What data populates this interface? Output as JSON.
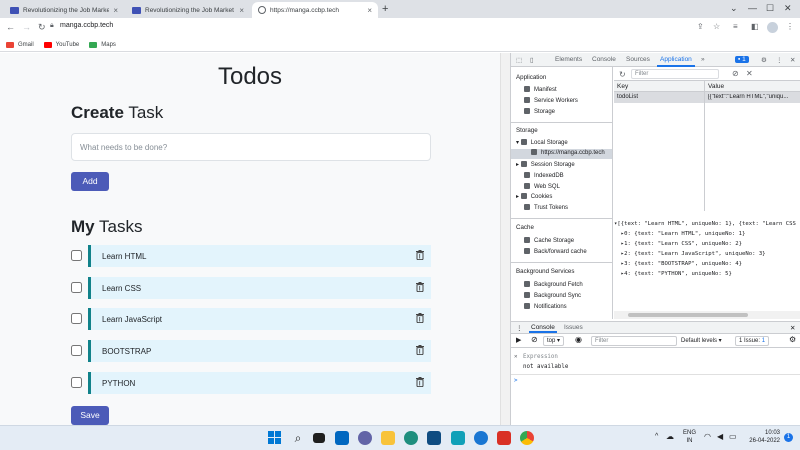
{
  "browser": {
    "tabs": [
      {
        "title": "Revolutionizing the Job Market |"
      },
      {
        "title": "Revolutionizing the Job Market |"
      },
      {
        "title": "https://manga.ccbp.tech"
      }
    ],
    "url": "manga.ccbp.tech",
    "bookmarks": [
      {
        "label": "Gmail",
        "color": "#ea4335"
      },
      {
        "label": "YouTube",
        "color": "#ff0000"
      },
      {
        "label": "Maps",
        "color": "#34a853"
      }
    ]
  },
  "app": {
    "title": "Todos",
    "create": {
      "bold": "Create",
      "rest": " Task"
    },
    "input_placeholder": "What needs to be done?",
    "add_label": "Add",
    "tasks_heading": {
      "bold": "My",
      "rest": " Tasks"
    },
    "tasks": [
      {
        "text": "Learn HTML",
        "checked": false
      },
      {
        "text": "Learn CSS",
        "checked": false
      },
      {
        "text": "Learn JavaScript",
        "checked": false
      },
      {
        "text": "BOOTSTRAP",
        "checked": false
      },
      {
        "text": "PYTHON",
        "checked": false
      }
    ],
    "save_label": "Save"
  },
  "devtools": {
    "tabs": [
      "Elements",
      "Console",
      "Sources",
      "Application"
    ],
    "active_tab": "Application",
    "more": "»",
    "issues_badge": "1",
    "sidebar": {
      "application": {
        "title": "Application",
        "items": [
          "Manifest",
          "Service Workers",
          "Storage"
        ]
      },
      "storage": {
        "title": "Storage",
        "local_storage": "Local Storage",
        "local_origin": "https://manga.ccbp.tech",
        "items": [
          "Session Storage",
          "IndexedDB",
          "Web SQL",
          "Cookies",
          "Trust Tokens"
        ]
      },
      "cache": {
        "title": "Cache",
        "items": [
          "Cache Storage",
          "Back/forward cache"
        ]
      },
      "background": {
        "title": "Background Services",
        "items": [
          "Background Fetch",
          "Background Sync",
          "Notifications"
        ]
      }
    },
    "filter_placeholder": "Filter",
    "table": {
      "key_header": "Key",
      "value_header": "Value",
      "row": {
        "key": "todoList",
        "value": "[{\"text\":\"Learn HTML\",\"uniqu..."
      }
    },
    "object_view": {
      "summary": "[{text: \"Learn HTML\", uniqueNo: 1}, {text: \"Learn CSS",
      "entries": [
        "0: {text: \"Learn HTML\", uniqueNo: 1}",
        "1: {text: \"Learn CSS\", uniqueNo: 2}",
        "2: {text: \"Learn JavaScript\", uniqueNo: 3}",
        "3: {text: \"BOOTSTRAP\", uniqueNo: 4}",
        "4: {text: \"PYTHON\", uniqueNo: 5}"
      ]
    },
    "drawer": {
      "tabs": [
        "Console",
        "Issues"
      ],
      "context": "top ▾",
      "filter_placeholder": "Filter",
      "levels": "Default levels ▾",
      "issues": "1 Issue: ",
      "issues_count": "1",
      "expression_label": "Expression",
      "expression_value": "not available",
      "prompt": ">"
    }
  },
  "taskbar": {
    "lang": "ENG",
    "region": "IN",
    "time": "10:03",
    "date": "26-04-2022",
    "notif": "1"
  }
}
